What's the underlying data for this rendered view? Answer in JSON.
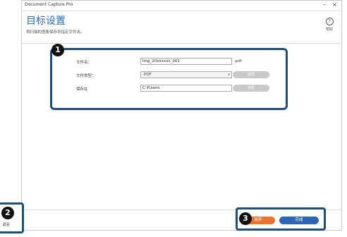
{
  "window": {
    "title": "Document Capture Pro",
    "minimize_glyph": "–",
    "close_glyph": "×"
  },
  "header": {
    "title": "目标设置",
    "subtitle": "将扫描的图像保存到指定文件夹。"
  },
  "help": {
    "icon": "question-circle-icon",
    "glyph": "?",
    "label": "帮助"
  },
  "form": {
    "filename": {
      "label": "文件名：",
      "value": "Img_20xxxxxx_001",
      "suffix": ".pdf"
    },
    "filetype": {
      "label": "文件类型：",
      "value": "PDF",
      "options_button": "选项"
    },
    "saveto": {
      "label": "保存在",
      "value": "C:¥Users",
      "browse_button": "浏览"
    }
  },
  "footer": {
    "back_label": "返回",
    "back_icon": "return-arrow-icon",
    "back_glyph": "⮌",
    "cancel_label": "放弃",
    "finish_label": "完成"
  },
  "callouts": [
    "1",
    "2",
    "3"
  ],
  "colors": {
    "accent": "#2d6fb3",
    "callout_border": "#1f4e79",
    "cancel": "#e8762f",
    "finish": "#2f66b2"
  }
}
